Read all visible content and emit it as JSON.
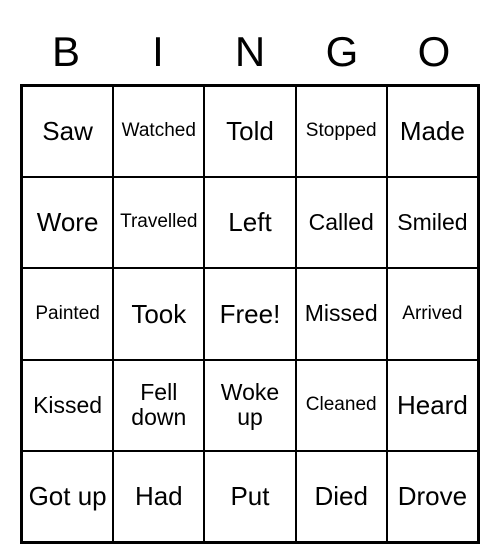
{
  "headers": [
    "B",
    "I",
    "N",
    "G",
    "O"
  ],
  "cells": [
    {
      "text": "Saw",
      "size": "normal"
    },
    {
      "text": "Watched",
      "size": "small"
    },
    {
      "text": "Told",
      "size": "normal"
    },
    {
      "text": "Stopped",
      "size": "small"
    },
    {
      "text": "Made",
      "size": "normal"
    },
    {
      "text": "Wore",
      "size": "normal"
    },
    {
      "text": "Travelled",
      "size": "small"
    },
    {
      "text": "Left",
      "size": "normal"
    },
    {
      "text": "Called",
      "size": "medium"
    },
    {
      "text": "Smiled",
      "size": "medium"
    },
    {
      "text": "Painted",
      "size": "small"
    },
    {
      "text": "Took",
      "size": "normal"
    },
    {
      "text": "Free!",
      "size": "normal"
    },
    {
      "text": "Missed",
      "size": "medium"
    },
    {
      "text": "Arrived",
      "size": "small"
    },
    {
      "text": "Kissed",
      "size": "medium"
    },
    {
      "text": "Fell down",
      "size": "medium"
    },
    {
      "text": "Woke up",
      "size": "medium"
    },
    {
      "text": "Cleaned",
      "size": "small"
    },
    {
      "text": "Heard",
      "size": "normal"
    },
    {
      "text": "Got up",
      "size": "normal"
    },
    {
      "text": "Had",
      "size": "normal"
    },
    {
      "text": "Put",
      "size": "normal"
    },
    {
      "text": "Died",
      "size": "normal"
    },
    {
      "text": "Drove",
      "size": "normal"
    }
  ]
}
